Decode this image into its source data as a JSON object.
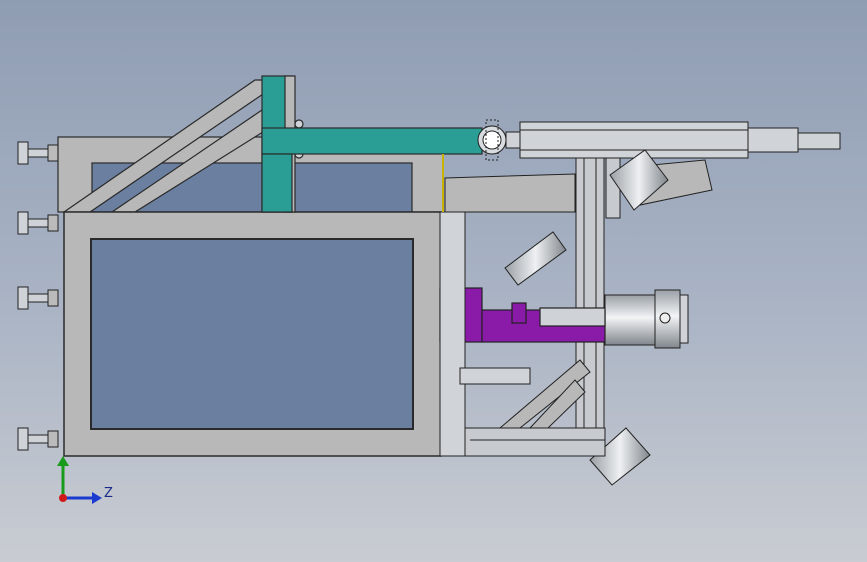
{
  "viewport": {
    "background_top": "#8f9db3",
    "background_bottom": "#c9ccd2"
  },
  "triad": {
    "z_label": "Z",
    "y_color": "#1a9a1a",
    "z_color": "#1a3ad0",
    "origin_color": "#d01a1a"
  },
  "colors": {
    "frame": "#b8b8b8",
    "frame_edge": "#2a2a2a",
    "panel": "#6b7fa0",
    "teal": "#2a9d95",
    "purple": "#8a1aa8",
    "steel": "#cfd3d8"
  }
}
